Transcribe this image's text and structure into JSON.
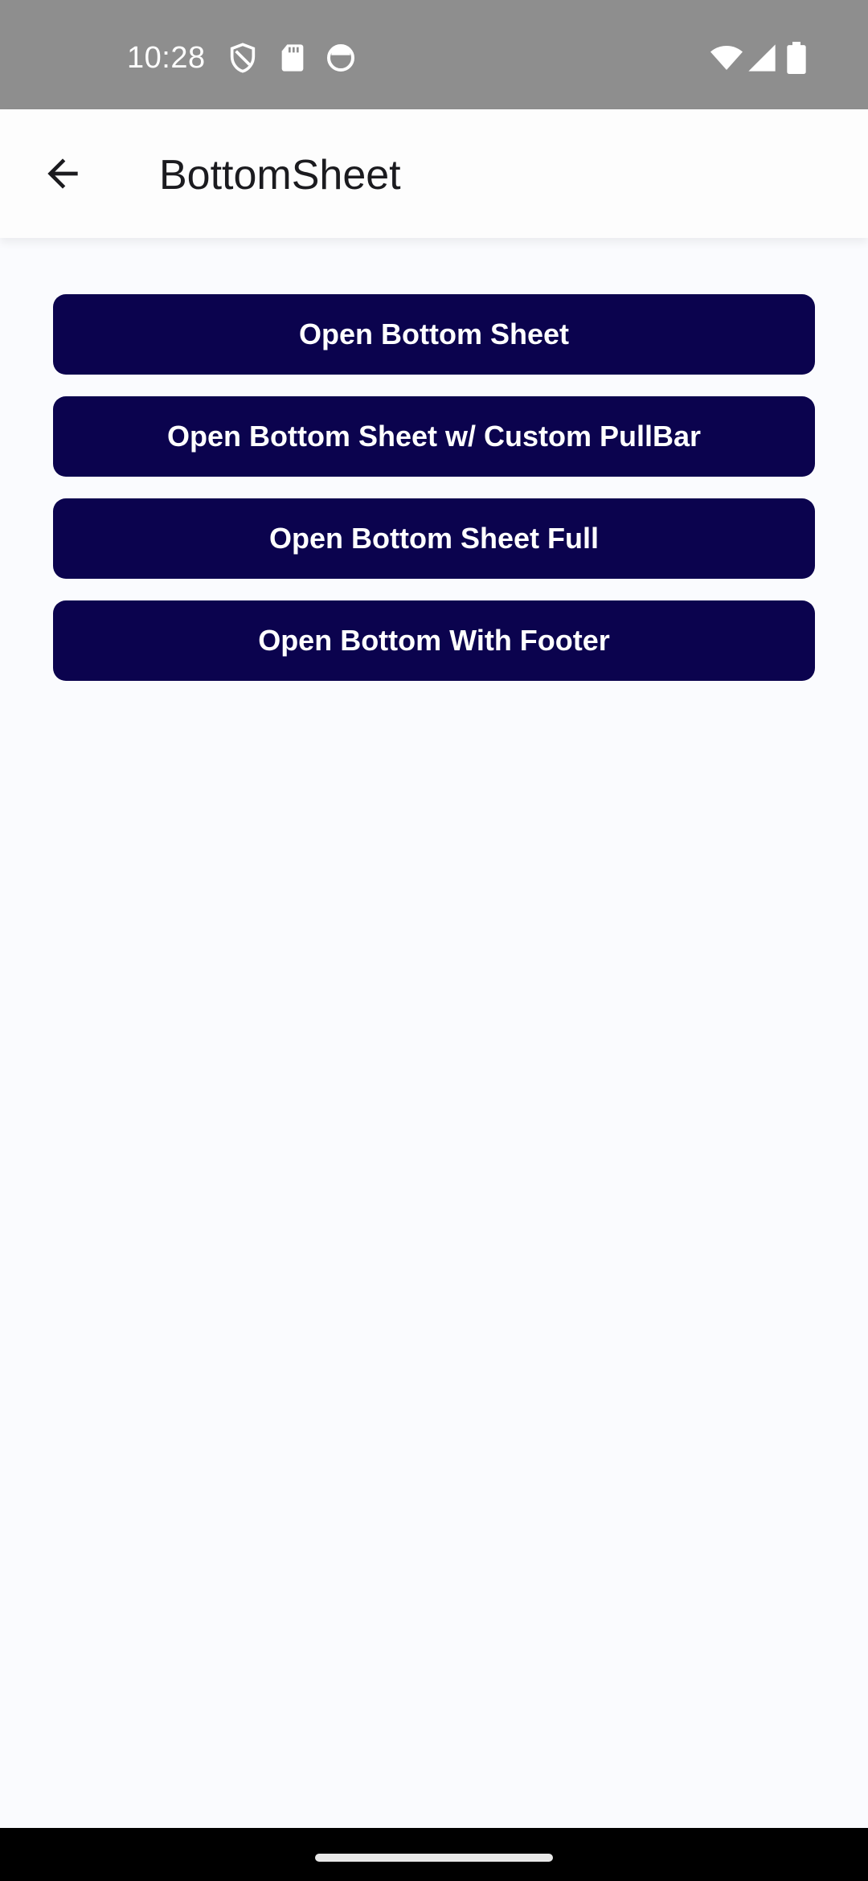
{
  "status_bar": {
    "time": "10:28",
    "icons": [
      "shield-icon",
      "sd-card-icon",
      "circle-badge-icon",
      "wifi-icon",
      "cell-signal-icon",
      "battery-icon"
    ],
    "background": "#8e8e8e"
  },
  "app_bar": {
    "back_icon": "arrow-back-icon",
    "title": "BottomSheet"
  },
  "buttons": [
    {
      "label": "Open Bottom Sheet"
    },
    {
      "label": "Open Bottom Sheet w/ Custom PullBar"
    },
    {
      "label": "Open Bottom Sheet Full"
    },
    {
      "label": "Open Bottom With Footer"
    }
  ],
  "colors": {
    "button_background": "#0b034e",
    "button_text": "#ffffff",
    "page_background": "#fafbfe"
  }
}
